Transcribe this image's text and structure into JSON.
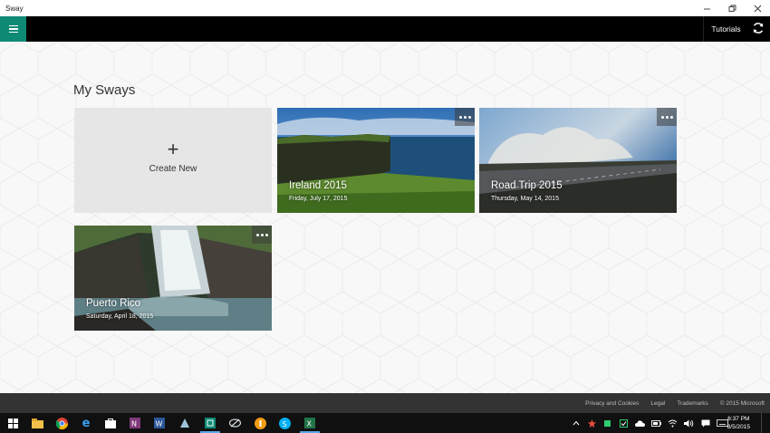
{
  "window": {
    "title": "Sway",
    "controls": [
      "minimize",
      "restore",
      "close"
    ]
  },
  "appbar": {
    "menu_icon": "hamburger-icon",
    "tutorials_label": "Tutorials",
    "refresh_icon": "sync-icon",
    "accent_color": "#0e8a74"
  },
  "main": {
    "heading": "My Sways",
    "create_tile": {
      "icon": "plus-icon",
      "label": "Create New"
    },
    "sways": [
      {
        "title": "Ireland 2015",
        "date": "Friday, July 17, 2015",
        "menu_icon": "more-icon"
      },
      {
        "title": "Road Trip 2015",
        "date": "Thursday, May 14, 2015",
        "menu_icon": "more-icon"
      },
      {
        "title": "Puerto Rico",
        "date": "Saturday, April 18, 2015",
        "menu_icon": "more-icon"
      }
    ]
  },
  "footer": {
    "links": [
      "Privacy and Cookies",
      "Legal",
      "Trademarks"
    ],
    "copyright": "© 2015 Microsoft"
  },
  "taskbar": {
    "apps": [
      "start-icon",
      "file-explorer-icon",
      "chrome-icon",
      "edge-icon",
      "store-icon",
      "onenote-icon",
      "word-icon",
      "app-icon",
      "sway-app-icon",
      "app-icon",
      "orange-app-icon",
      "skype-icon",
      "excel-icon"
    ],
    "tray_icons": [
      "chevron-up-icon",
      "app-icon",
      "app-icon",
      "app-icon",
      "onedrive-icon",
      "battery-icon",
      "wifi-icon",
      "volume-icon",
      "action-center-icon",
      "keyboard-icon"
    ],
    "time": "6:37 PM",
    "date": "8/5/2015"
  }
}
